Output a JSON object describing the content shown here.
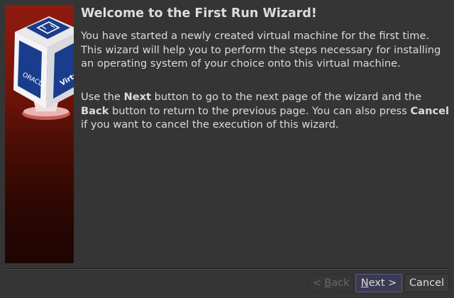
{
  "wizard": {
    "title": "Welcome to the First Run Wizard!",
    "intro": "You have started a newly created virtual machine for the first time. This wizard will help you to perform the steps necessary for installing an operating system of your choice onto this virtual machine.",
    "instructions": {
      "use_the": "Use the ",
      "next_word": "Next",
      "after_next": " button to go to the next page of the wizard and the ",
      "back_word": "Back",
      "after_back": " button to return to the previous page. You can also press ",
      "cancel_word": "Cancel",
      "after_cancel": " if you want to cancel the execution of this wizard."
    }
  },
  "logo": {
    "brand_text": "ORACLE",
    "side_text": "Virtu"
  },
  "buttons": {
    "back": {
      "pre": "< ",
      "mnemonic": "B",
      "post": "ack",
      "enabled": false
    },
    "next": {
      "mnemonic": "N",
      "post": "ext >"
    },
    "cancel": {
      "label": "Cancel"
    }
  },
  "colors": {
    "background": "#353535",
    "banner_top": "#8e1b0e",
    "banner_bottom": "#1f0502",
    "text": "#dcdcdc",
    "logo_blue": "#1a3c8c",
    "default_button_border": "#5c5a88"
  }
}
